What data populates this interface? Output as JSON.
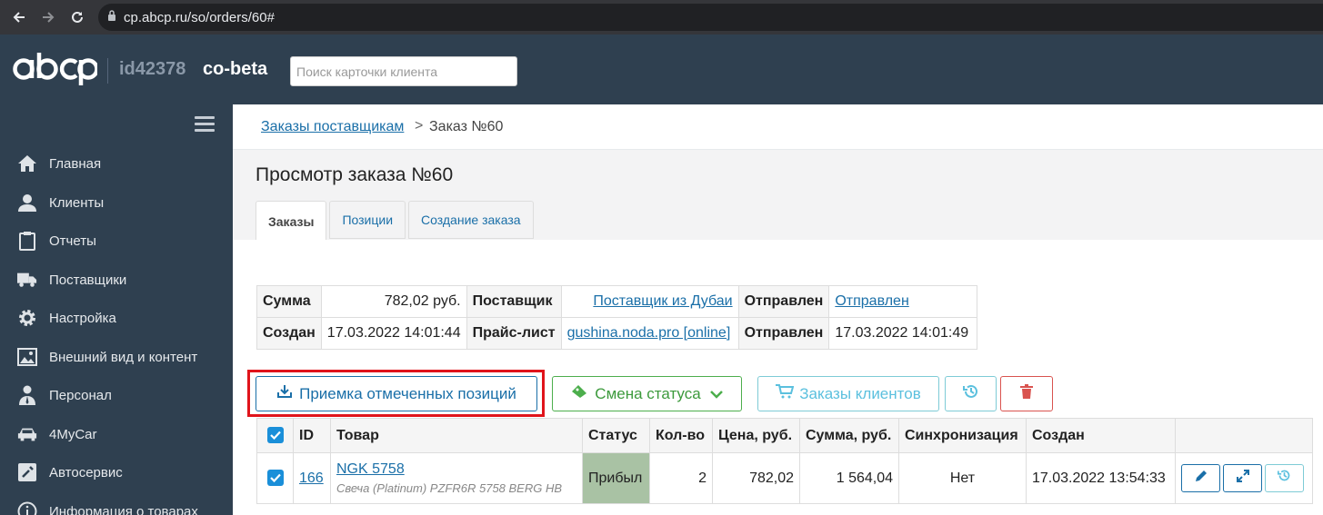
{
  "browser": {
    "url": "cp.abcp.ru/so/orders/60#"
  },
  "header": {
    "logo_text": "abcp",
    "account_id": "id42378",
    "account_name": "co-beta",
    "search_placeholder": "Поиск карточки клиента"
  },
  "sidebar": {
    "items": [
      {
        "label": "Главная",
        "icon": "home-icon"
      },
      {
        "label": "Клиенты",
        "icon": "user-icon"
      },
      {
        "label": "Отчеты",
        "icon": "clipboard-icon"
      },
      {
        "label": "Поставщики",
        "icon": "truck-icon"
      },
      {
        "label": "Настройка",
        "icon": "gear-icon"
      },
      {
        "label": "Внешний вид и контент",
        "icon": "image-icon"
      },
      {
        "label": "Персонал",
        "icon": "staff-icon"
      },
      {
        "label": "4MyCar",
        "icon": "car-icon"
      },
      {
        "label": "Автосервис",
        "icon": "wrench-icon"
      },
      {
        "label": "Информация о товарах",
        "icon": "info-icon"
      }
    ]
  },
  "breadcrumb": {
    "link": "Заказы поставщикам",
    "separator": ">",
    "current": "Заказ №60"
  },
  "page_title": "Просмотр заказа №60",
  "tabs": [
    {
      "label": "Заказы",
      "active": true
    },
    {
      "label": "Позиции",
      "active": false
    },
    {
      "label": "Создание заказа",
      "active": false
    }
  ],
  "info": {
    "sum_label": "Сумма",
    "sum_value": "782,02 руб.",
    "supplier_label": "Поставщик",
    "supplier_value": "Поставщик из Дубаи",
    "sent_label": "Отправлен",
    "sent_value": "Отправлен",
    "created_label": "Создан",
    "created_value": "17.03.2022 14:01:44",
    "pricelist_label": "Прайс-лист",
    "pricelist_value": "gushina.noda.pro [online]",
    "sent2_label": "Отправлен",
    "sent2_value": "17.03.2022 14:01:49"
  },
  "actions": {
    "receive_label": "Приемка отмеченных позиций",
    "status_label": "Смена статуса",
    "client_orders_label": "Заказы клиентов"
  },
  "grid": {
    "columns": [
      "ID",
      "Товар",
      "Статус",
      "Кол-во",
      "Цена, руб.",
      "Сумма, руб.",
      "Синхронизация",
      "Создан"
    ],
    "rows": [
      {
        "id": "166",
        "product": "NGK 5758",
        "product_desc": "Свеча (Platinum) PZFR6R 5758 BERG HB",
        "status": "Прибыл",
        "qty": "2",
        "price": "782,02",
        "sum": "1 564,04",
        "sync": "Нет",
        "created": "17.03.2022 13:54:33"
      }
    ]
  },
  "colors": {
    "sidebar_bg": "#2f4050",
    "link": "#1a6fa8",
    "status_arrived_bg": "#a9c2a4",
    "highlight": "#e0141b"
  }
}
